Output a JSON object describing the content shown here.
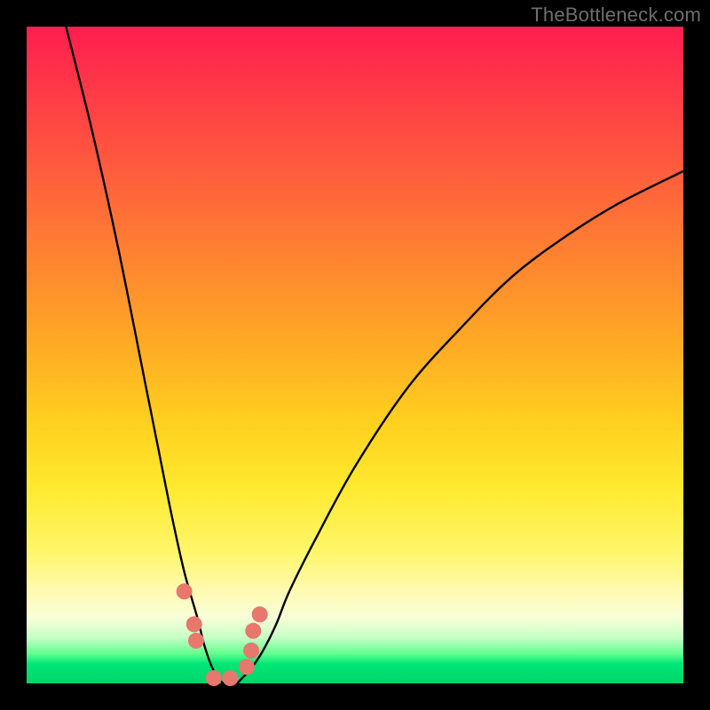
{
  "watermark": "TheBottleneck.com",
  "chart_data": {
    "type": "line",
    "title": "",
    "xlabel": "",
    "ylabel": "",
    "xlim": [
      0,
      100
    ],
    "ylim": [
      0,
      100
    ],
    "series": [
      {
        "name": "bottleneck-curve",
        "x": [
          6,
          10,
          14,
          18,
          20,
          22,
          24,
          26,
          27,
          28,
          29,
          30,
          31,
          32,
          33,
          34,
          36,
          38,
          40,
          44,
          50,
          58,
          66,
          74,
          82,
          90,
          100
        ],
        "values": [
          100,
          84,
          66,
          46,
          36,
          26,
          17,
          10,
          6,
          3,
          1,
          0,
          0,
          0,
          1,
          2,
          5,
          9,
          14,
          22,
          33,
          45,
          54,
          62,
          68,
          73,
          78
        ]
      }
    ],
    "markers": {
      "name": "highlight-dots",
      "x": [
        24.0,
        25.5,
        25.8,
        28.5,
        31.0,
        33.5,
        34.2,
        34.5,
        35.5
      ],
      "values": [
        14.0,
        9.0,
        6.5,
        0.8,
        0.8,
        2.5,
        5.0,
        8.0,
        10.5
      ],
      "color": "#e8776d",
      "radius_px": 9
    },
    "gradient_stops": [
      {
        "pos": 0.0,
        "color": "#ff1d50"
      },
      {
        "pos": 0.18,
        "color": "#ff5140"
      },
      {
        "pos": 0.46,
        "color": "#ffa326"
      },
      {
        "pos": 0.7,
        "color": "#ffe92e"
      },
      {
        "pos": 0.9,
        "color": "#f8ffd8"
      },
      {
        "pos": 0.97,
        "color": "#00e676"
      },
      {
        "pos": 1.0,
        "color": "#00d56a"
      }
    ]
  }
}
